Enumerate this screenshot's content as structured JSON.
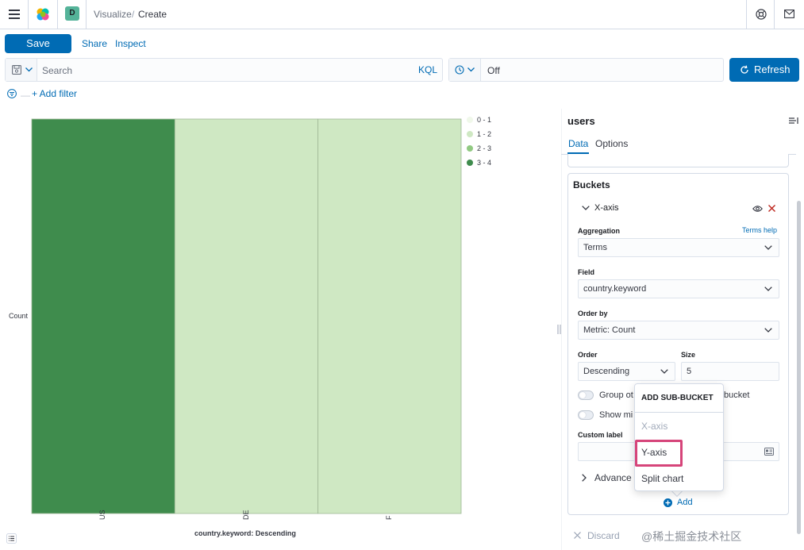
{
  "header": {
    "space_initial": "D",
    "breadcrumb_parent": "Visualize",
    "breadcrumb_separator": "/",
    "breadcrumb_current": "Create"
  },
  "toolbar": {
    "save_label": "Save",
    "share_label": "Share",
    "inspect_label": "Inspect"
  },
  "search": {
    "placeholder": "Search",
    "language": "KQL"
  },
  "time": {
    "refresh_interval": "Off",
    "refresh_label": "Refresh"
  },
  "filters": {
    "add_label": "+ Add filter"
  },
  "chart_data": {
    "type": "heatmap",
    "categories": [
      "US",
      "DE",
      "F"
    ],
    "bucket_ranges": [
      "0 - 1",
      "1 - 2",
      "2 - 3",
      "3 - 4"
    ],
    "bucket_colors": [
      "#f0f8ea",
      "#cfe8c3",
      "#91c982",
      "#3f8c4d"
    ],
    "cell_bucket_index": [
      3,
      1,
      1
    ],
    "ylabel": "Count",
    "xlabel": "country.keyword: Descending",
    "legend_position": "right"
  },
  "sidebar": {
    "index_pattern": "users",
    "tabs": [
      {
        "label": "Data",
        "active": true
      },
      {
        "label": "Options",
        "active": false
      }
    ],
    "buckets_title": "Buckets",
    "xaxis": {
      "title": "X-axis",
      "aggregation_label": "Aggregation",
      "aggregation_help": "Terms help",
      "aggregation_value": "Terms",
      "field_label": "Field",
      "field_value": "country.keyword",
      "order_by_label": "Order by",
      "order_by_value": "Metric: Count",
      "order_label": "Order",
      "order_value": "Descending",
      "size_label": "Size",
      "size_value": "5",
      "group_other_label": "Group ot",
      "group_other_label_tail": "bucket",
      "show_missing_label": "Show mi",
      "custom_label_label": "Custom label",
      "advanced_label": "Advance"
    },
    "add_label": "Add",
    "discard_label": "Discard"
  },
  "popover": {
    "title": "ADD SUB-BUCKET",
    "items": [
      {
        "label": "X-axis",
        "disabled": true
      },
      {
        "label": "Y-axis",
        "disabled": false
      },
      {
        "label": "Split chart",
        "disabled": false
      }
    ]
  },
  "accent_color": "#006bb4",
  "highlight_color": "#d6457a",
  "watermark_text": "@稀土掘金技术社区"
}
